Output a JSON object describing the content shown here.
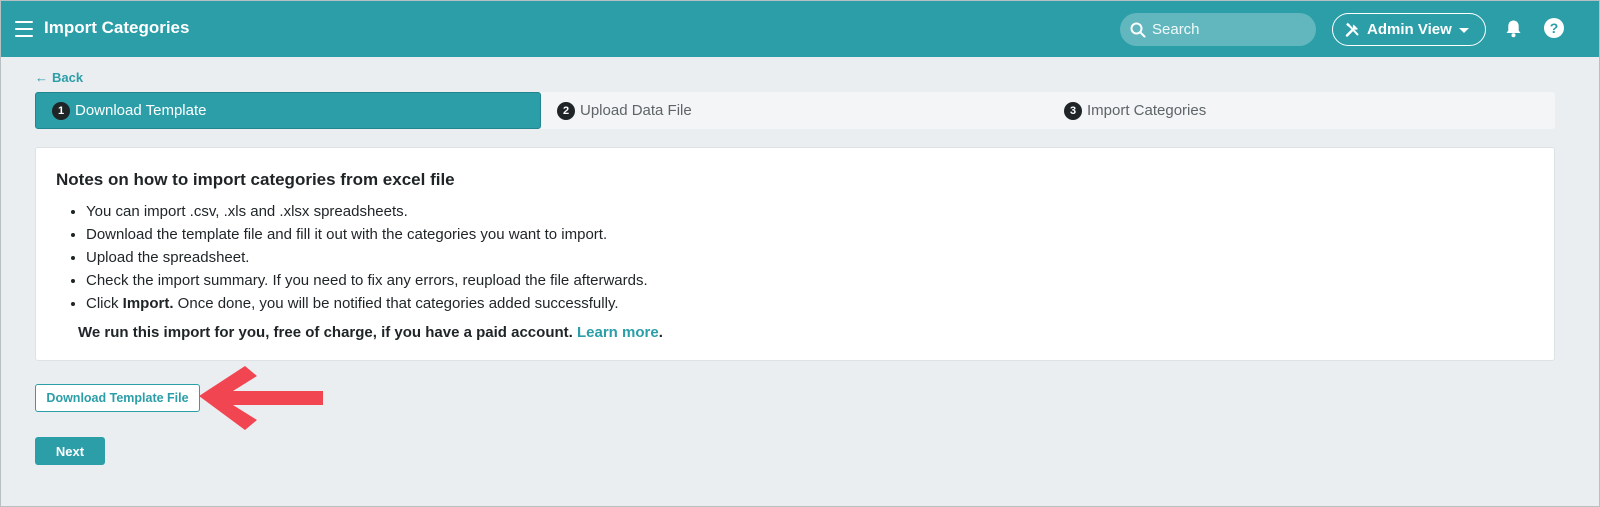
{
  "header": {
    "title": "Import Categories",
    "search_placeholder": "Search",
    "admin_view_label": "Admin View",
    "help_glyph": "?"
  },
  "back_label": "Back",
  "stepper": [
    {
      "num": "1",
      "label": "Download Template",
      "active": true
    },
    {
      "num": "2",
      "label": "Upload Data File",
      "active": false
    },
    {
      "num": "3",
      "label": "Import Categories",
      "active": false
    }
  ],
  "notes": {
    "title": "Notes on how to import categories from excel file",
    "items": [
      "You can import .csv, .xls and .xlsx spreadsheets.",
      "Download the template file and fill it out with the categories you want to import.",
      "Upload the spreadsheet.",
      "Check the import summary. If you need to fix any errors, reupload the file afterwards."
    ],
    "last_item_prefix": "Click ",
    "last_item_bold": "Import.",
    "last_item_suffix": " Once done, you will be notified that categories added successfully.",
    "promo_text": "We run this import for you, free of charge, if you have a paid account. ",
    "promo_link": "Learn more",
    "promo_end": "."
  },
  "buttons": {
    "download_template": "Download Template File",
    "next": "Next"
  },
  "colors": {
    "brand": "#2b9ea8",
    "annotation_arrow": "#f24552"
  },
  "icons": {
    "menu": "hamburger-icon",
    "search": "search-icon",
    "admin": "tools-icon",
    "notifications": "bell-icon",
    "help": "question-icon",
    "back": "arrow-left-icon"
  }
}
